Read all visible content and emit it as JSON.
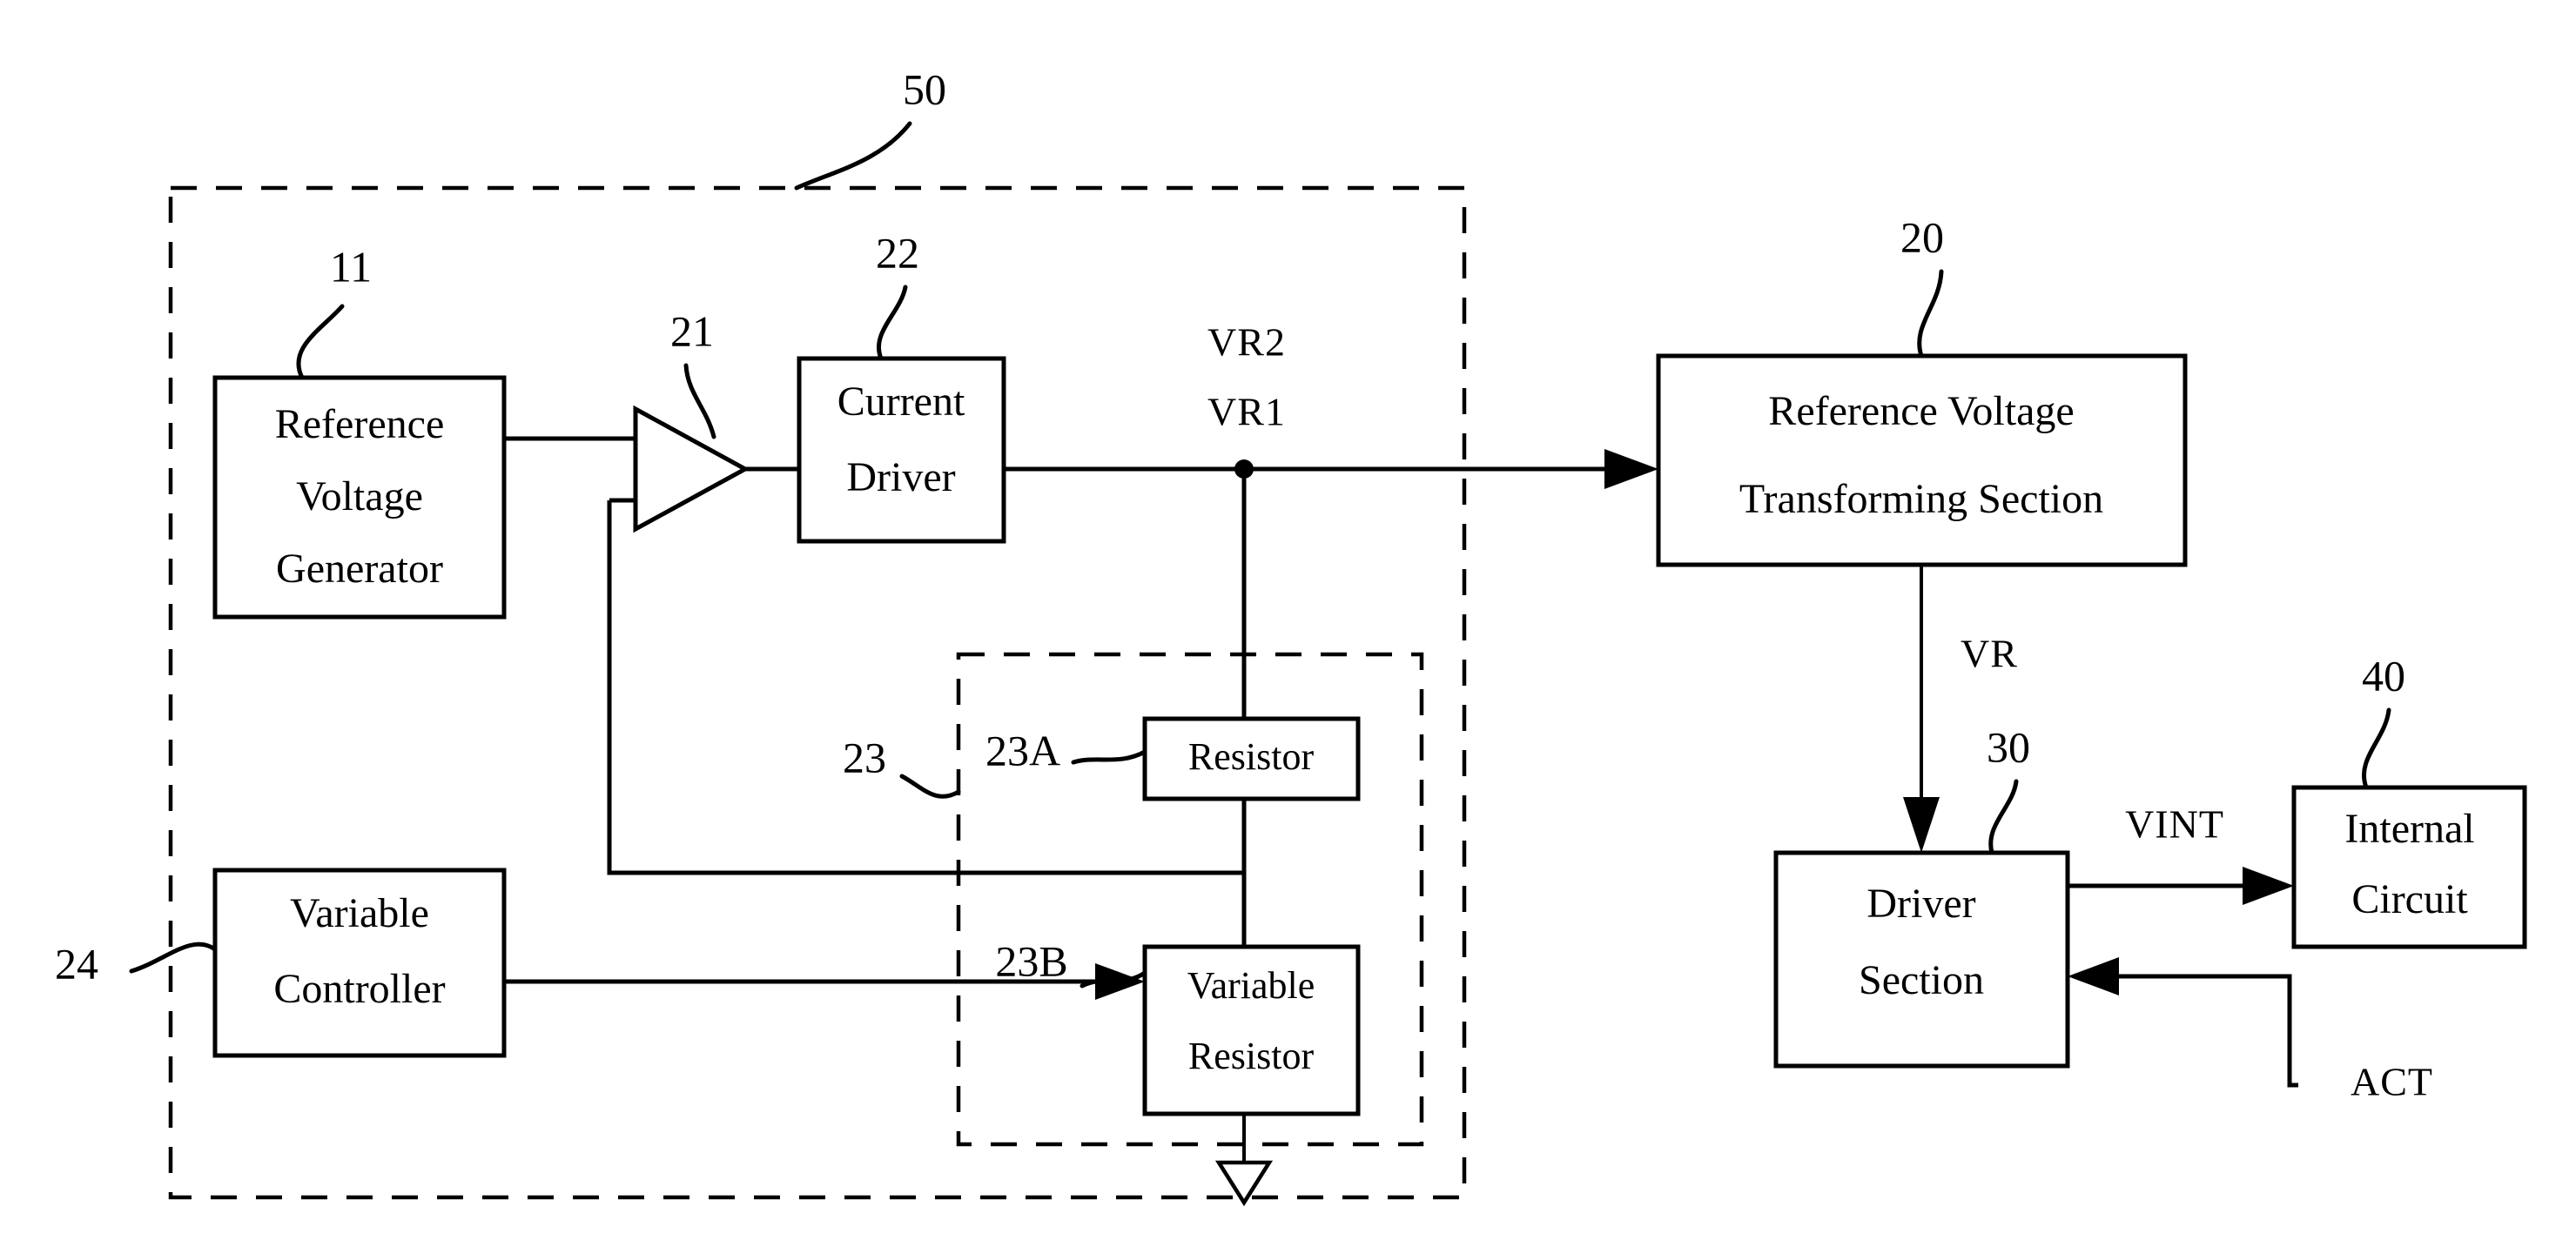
{
  "figure": {
    "type": "patent-block-diagram",
    "background_color": "#ffffff",
    "line_color": "#000000"
  },
  "reference_numerals": {
    "internal_voltage_generator_block": "50",
    "reference_voltage_generator": "11",
    "comparator": "21",
    "current_driver": "22",
    "resistor_string": "23",
    "resistor": "23A",
    "variable_resistor": "23B",
    "variable_controller": "24",
    "reference_voltage_transforming_section": "20",
    "driver_section": "30",
    "internal_circuit": "40"
  },
  "blocks": {
    "reference_voltage_generator": {
      "label_lines": [
        "Reference",
        "Voltage",
        "Generator"
      ],
      "ref": "11"
    },
    "current_driver": {
      "label_lines": [
        "Current",
        "Driver"
      ],
      "ref": "22"
    },
    "resistor": {
      "label_lines": [
        "Resistor"
      ],
      "ref": "23A"
    },
    "variable_resistor": {
      "label_lines": [
        "Variable",
        "Resistor"
      ],
      "ref": "23B"
    },
    "variable_controller": {
      "label_lines": [
        "Variable",
        "Controller"
      ],
      "ref": "24"
    },
    "reference_voltage_transforming_section": {
      "label_lines": [
        "Reference Voltage",
        "Transforming Section"
      ],
      "ref": "20"
    },
    "driver_section": {
      "label_lines": [
        "Driver",
        "Section"
      ],
      "ref": "30"
    },
    "internal_circuit": {
      "label_lines": [
        "Internal",
        "Circuit"
      ],
      "ref": "40"
    }
  },
  "signals": {
    "vr2": "VR2",
    "vr1": "VR1",
    "vr": "VR",
    "vint": "VINT",
    "act": "ACT"
  }
}
